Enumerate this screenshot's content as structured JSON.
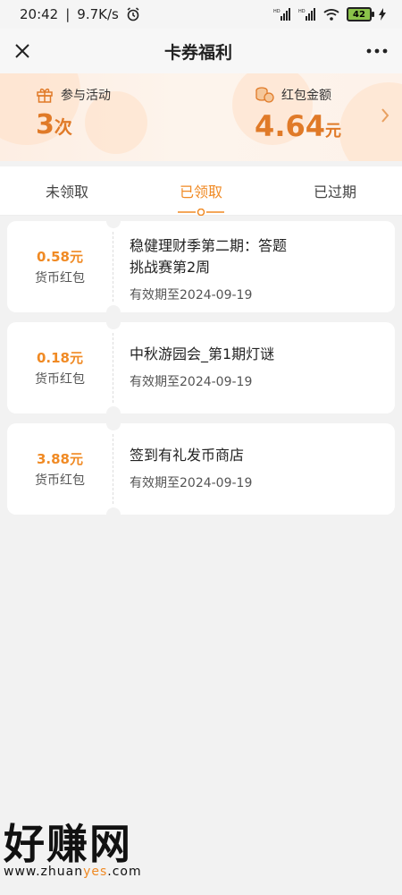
{
  "status_bar": {
    "time": "20:42",
    "speed": "9.7K/s",
    "battery": "42",
    "icons": [
      "alarm-icon",
      "signal-hd-icon",
      "signal-hd-icon",
      "wifi-icon",
      "battery-icon",
      "charging-icon"
    ]
  },
  "header": {
    "title": "卡券福利",
    "close_icon": "close-icon",
    "more_icon": "more-icon"
  },
  "summary": {
    "activities_label": "参与活动",
    "activities_value": "3",
    "activities_unit": "次",
    "redpacket_label": "红包金额",
    "redpacket_value": "4.64",
    "redpacket_unit": "元"
  },
  "tabs": [
    {
      "label": "未领取",
      "active": false
    },
    {
      "label": "已领取",
      "active": true
    },
    {
      "label": "已过期",
      "active": false
    }
  ],
  "coupons": [
    {
      "amount": "0.58元",
      "type": "货币红包",
      "title": "稳健理财季第二期：答题挑战赛第2周",
      "expiry": "有效期至2024-09-19"
    },
    {
      "amount": "0.18元",
      "type": "货币红包",
      "title": "中秋游园会_第1期灯谜",
      "expiry": "有效期至2024-09-19"
    },
    {
      "amount": "3.88元",
      "type": "货币红包",
      "title": "签到有礼发币商店",
      "expiry": "有效期至2024-09-19"
    }
  ],
  "watermark": {
    "text": "好赚网",
    "url_prefix": "www.zhuan",
    "url_mid": "yes",
    "url_suffix": ".com"
  },
  "colors": {
    "accent": "#f08a24",
    "background": "#f2f2f2"
  }
}
